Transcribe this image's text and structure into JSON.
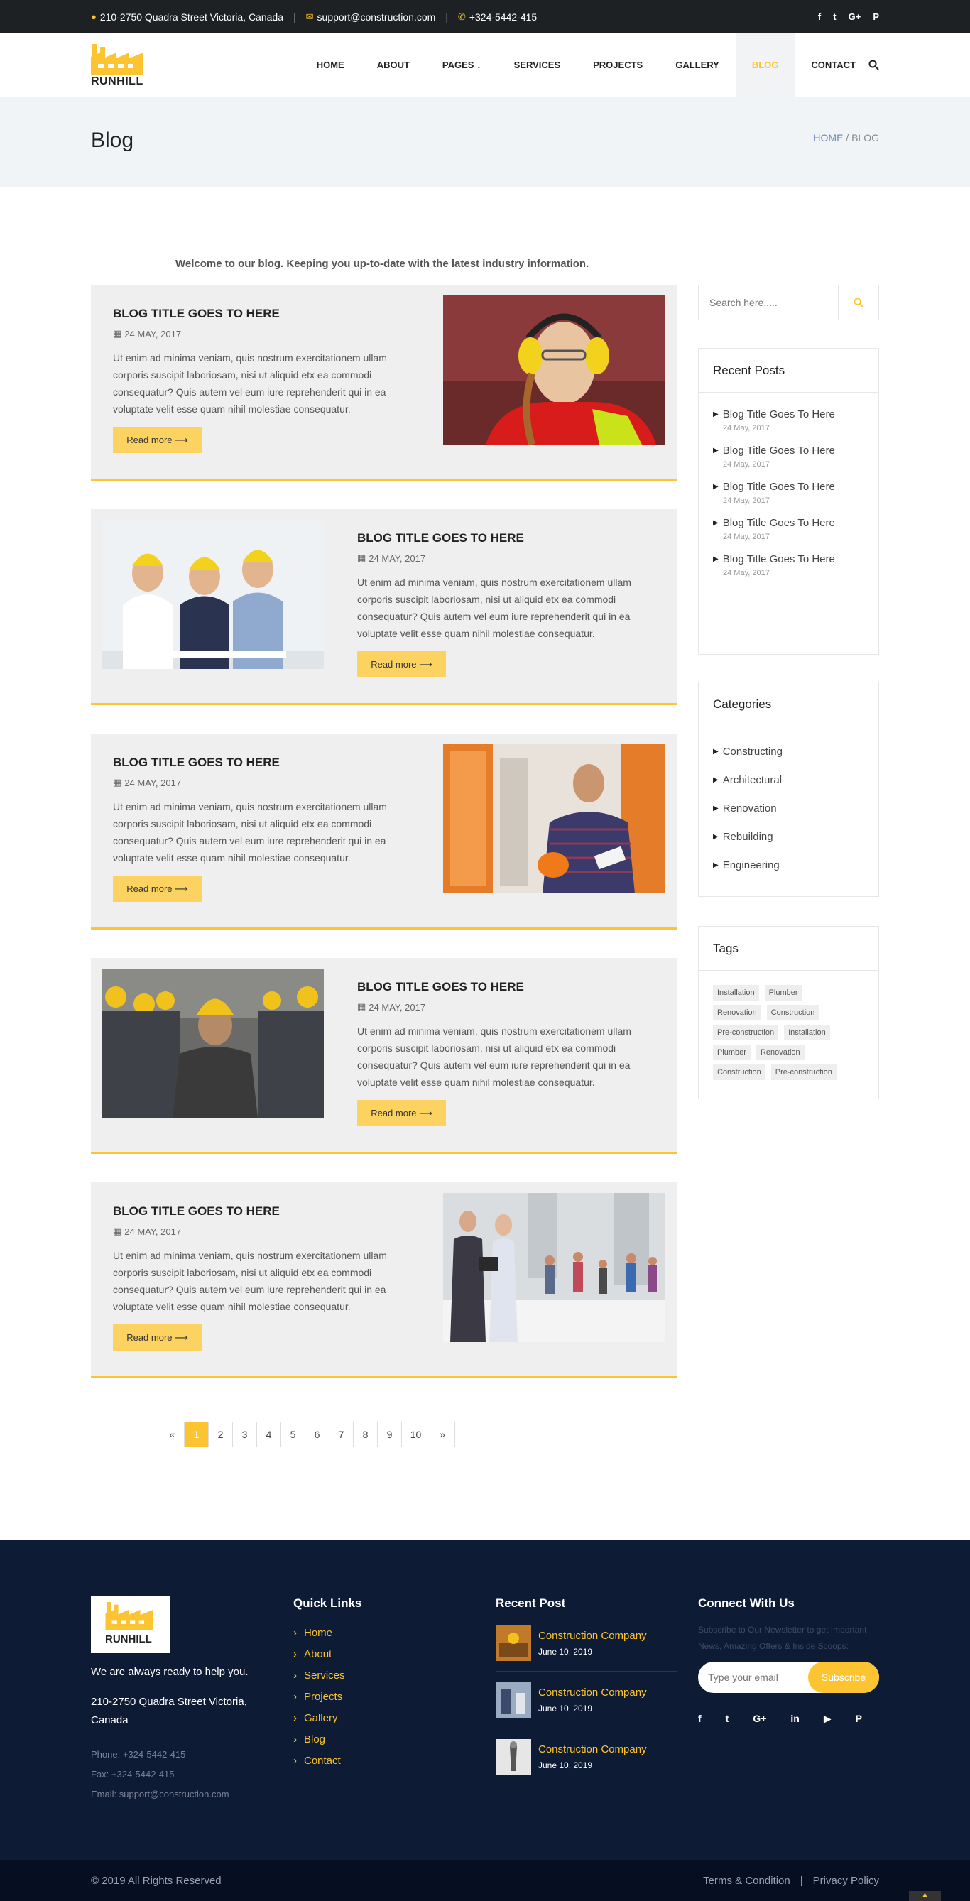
{
  "topbar": {
    "address": "210-2750 Quadra Street Victoria, Canada",
    "email": "support@construction.com",
    "phone": "+324-5442-415",
    "social_icons": [
      "facebook-icon",
      "twitter-icon",
      "google-plus-icon",
      "pinterest-icon"
    ]
  },
  "header": {
    "logo_text": "RUNHILL",
    "nav": [
      "HOME",
      "ABOUT",
      "PAGES",
      "SERVICES",
      "PROJECTS",
      "GALLERY",
      "BLOG",
      "CONTACT"
    ],
    "active_nav": "BLOG",
    "accent_color": "#fcc430"
  },
  "page_title": {
    "title": "Blog",
    "breadcrumb_home": "HOME",
    "breadcrumb_sep": " / ",
    "breadcrumb_current": "BLOG"
  },
  "intro": "Welcome to our blog. Keeping you up-to-date with the latest industry information.",
  "posts": [
    {
      "title": "BLOG TITLE GOES TO HERE",
      "date": "24 MAY, 2017",
      "excerpt": "Ut enim ad minima veniam, quis nostrum exercitationem ullam corporis suscipit laboriosam, nisi ut aliquid etx ea commodi consequatur? Quis autem vel eum iure reprehenderit qui in ea voluptate velit esse quam nihil molestiae consequatur.",
      "read_more": "Read more"
    },
    {
      "title": "BLOG TITLE GOES TO HERE",
      "date": "24 MAY, 2017",
      "excerpt": "Ut enim ad minima veniam, quis nostrum exercitationem ullam corporis suscipit laboriosam, nisi ut aliquid etx ea commodi consequatur? Quis autem vel eum iure reprehenderit qui in ea voluptate velit esse quam nihil molestiae consequatur.",
      "read_more": "Read more"
    },
    {
      "title": "BLOG TITLE GOES TO HERE",
      "date": "24 MAY, 2017",
      "excerpt": "Ut enim ad minima veniam, quis nostrum exercitationem ullam corporis suscipit laboriosam, nisi ut aliquid etx ea commodi consequatur? Quis autem vel eum iure reprehenderit qui in ea voluptate velit esse quam nihil molestiae consequatur.",
      "read_more": "Read more"
    },
    {
      "title": "BLOG TITLE GOES TO HERE",
      "date": "24 MAY, 2017",
      "excerpt": "Ut enim ad minima veniam, quis nostrum exercitationem ullam corporis suscipit laboriosam, nisi ut aliquid etx ea commodi consequatur? Quis autem vel eum iure reprehenderit qui in ea voluptate velit esse quam nihil molestiae consequatur.",
      "read_more": "Read more"
    },
    {
      "title": "BLOG TITLE GOES TO HERE",
      "date": "24 MAY, 2017",
      "excerpt": "Ut enim ad minima veniam, quis nostrum exercitationem ullam corporis suscipit laboriosam, nisi ut aliquid etx ea commodi consequatur? Quis autem vel eum iure reprehenderit qui in ea voluptate velit esse quam nihil molestiae consequatur.",
      "read_more": "Read more"
    }
  ],
  "pagination": {
    "prev": "«",
    "next": "»",
    "pages": [
      "1",
      "2",
      "3",
      "4",
      "5",
      "6",
      "7",
      "8",
      "9",
      "10"
    ],
    "current": "1"
  },
  "sidebar": {
    "search_placeholder": "Search here.....",
    "recent_title": "Recent Posts",
    "recent_posts": [
      {
        "title": "Blog Title Goes To Here",
        "date": "24 May, 2017"
      },
      {
        "title": "Blog Title Goes To Here",
        "date": "24 May, 2017"
      },
      {
        "title": "Blog Title Goes To Here",
        "date": "24 May, 2017"
      },
      {
        "title": "Blog Title Goes To Here",
        "date": "24 May, 2017"
      },
      {
        "title": "Blog Title Goes To Here",
        "date": "24 May, 2017"
      }
    ],
    "categories_title": "Categories",
    "categories": [
      "Constructing",
      "Architectural",
      "Renovation",
      "Rebuilding",
      "Engineering"
    ],
    "tags_title": "Tags",
    "tags": [
      "Installation",
      "Plumber",
      "Renovation",
      "Construction",
      "Pre-construction",
      "Installation",
      "Plumber",
      "Renovation",
      "Construction",
      "Pre-construction"
    ]
  },
  "footer": {
    "logo_text": "RUNHILL",
    "tagline": "We are always ready to help you.",
    "address": "210-2750 Quadra Street Victoria, Canada",
    "phone": "Phone: +324-5442-415",
    "fax": "Fax: +324-5442-415",
    "email": "Email: support@construction.com",
    "quick_links_title": "Quick Links",
    "quick_links": [
      "Home",
      "About",
      "Services",
      "Projects",
      "Gallery",
      "Blog",
      "Contact"
    ],
    "recent_post_title": "Recent Post",
    "recent_posts": [
      {
        "title": "Construction Company",
        "date": "June 10, 2019"
      },
      {
        "title": "Construction Company",
        "date": "June 10, 2019"
      },
      {
        "title": "Construction Company",
        "date": "June 10, 2019"
      }
    ],
    "connect_title": "Connect With Us",
    "newsletter_text": "Subscribe to Our Newsletter to get Important News, Amazing Offers & Inside Scoops:",
    "email_placeholder": "Type your email",
    "subscribe_label": "Subscribe",
    "social_icons": [
      "facebook-icon",
      "twitter-icon",
      "google-plus-icon",
      "linkedin-icon",
      "youtube-icon",
      "pinterest-icon"
    ],
    "copyright": "© 2019 All Rights Reserved",
    "terms": "Terms & Condition",
    "privacy": "Privacy Policy",
    "link_sep": "|"
  }
}
